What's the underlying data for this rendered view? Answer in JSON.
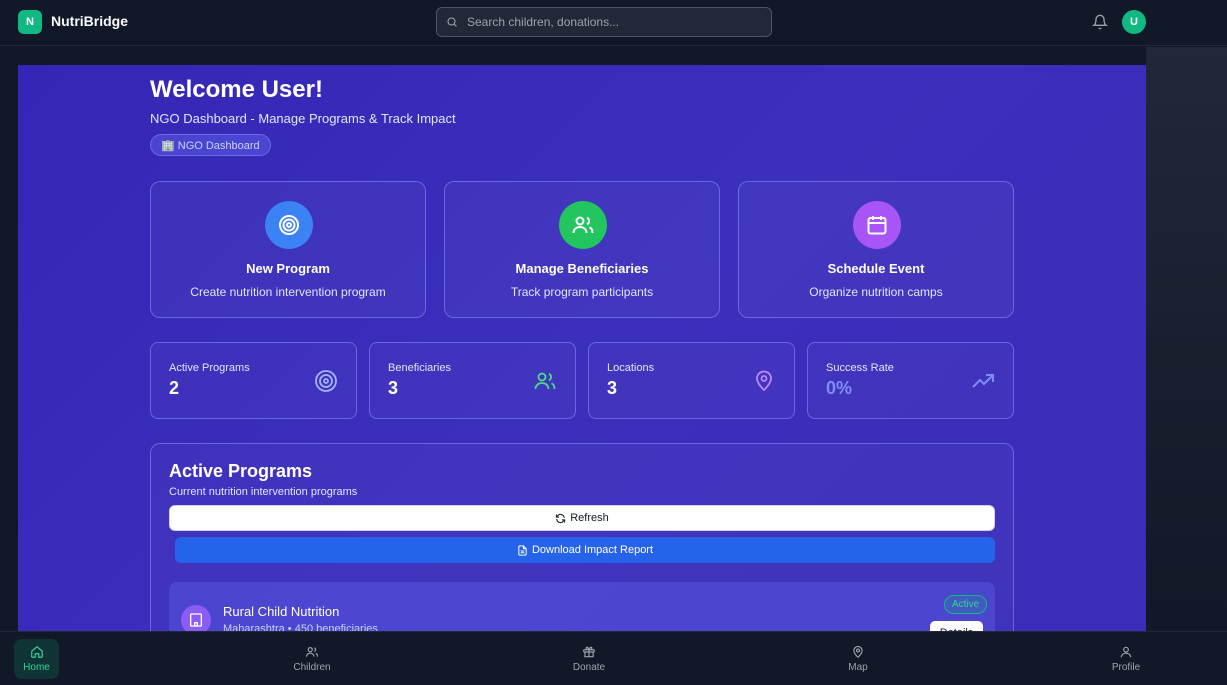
{
  "header": {
    "logo_letter": "N",
    "app_name": "NutriBridge",
    "search_placeholder": "Search children, donations...",
    "avatar_letter": "U"
  },
  "hero": {
    "title": "Welcome User!",
    "subtitle": "NGO Dashboard - Manage Programs & Track Impact",
    "badge": "🏢 NGO Dashboard"
  },
  "actions": [
    {
      "title": "New Program",
      "desc": "Create nutrition intervention program",
      "icon": "target-icon",
      "color": "#3b82f6"
    },
    {
      "title": "Manage Beneficiaries",
      "desc": "Track program participants",
      "icon": "users-icon",
      "color": "#22c55e"
    },
    {
      "title": "Schedule Event",
      "desc": "Organize nutrition camps",
      "icon": "calendar-icon",
      "color": "#a855f7"
    }
  ],
  "stats": [
    {
      "label": "Active Programs",
      "value": "2",
      "icon": "target-icon",
      "color": "#a5b4fc"
    },
    {
      "label": "Beneficiaries",
      "value": "3",
      "icon": "users-icon",
      "color": "#4ade80"
    },
    {
      "label": "Locations",
      "value": "3",
      "icon": "map-pin-icon",
      "color": "#c084fc"
    },
    {
      "label": "Success Rate",
      "value": "0%",
      "icon": "trending-up-icon",
      "color": "#818cf8"
    }
  ],
  "programs_panel": {
    "title": "Active Programs",
    "subtitle": "Current nutrition intervention programs",
    "refresh_label": "Refresh",
    "download_label": "Download Impact Report",
    "programs": [
      {
        "name": "Rural Child Nutrition",
        "meta": "Maharashtra • 450 beneficiaries",
        "status": "Active",
        "action": "Details"
      }
    ]
  },
  "nav": {
    "items": [
      {
        "label": "Home",
        "icon": "home-icon",
        "active": true
      },
      {
        "label": "Children",
        "icon": "users-icon",
        "active": false
      },
      {
        "label": "Donate",
        "icon": "gift-icon",
        "active": false
      },
      {
        "label": "Map",
        "icon": "map-pin-icon",
        "active": false
      },
      {
        "label": "Profile",
        "icon": "user-icon",
        "active": false
      }
    ]
  }
}
